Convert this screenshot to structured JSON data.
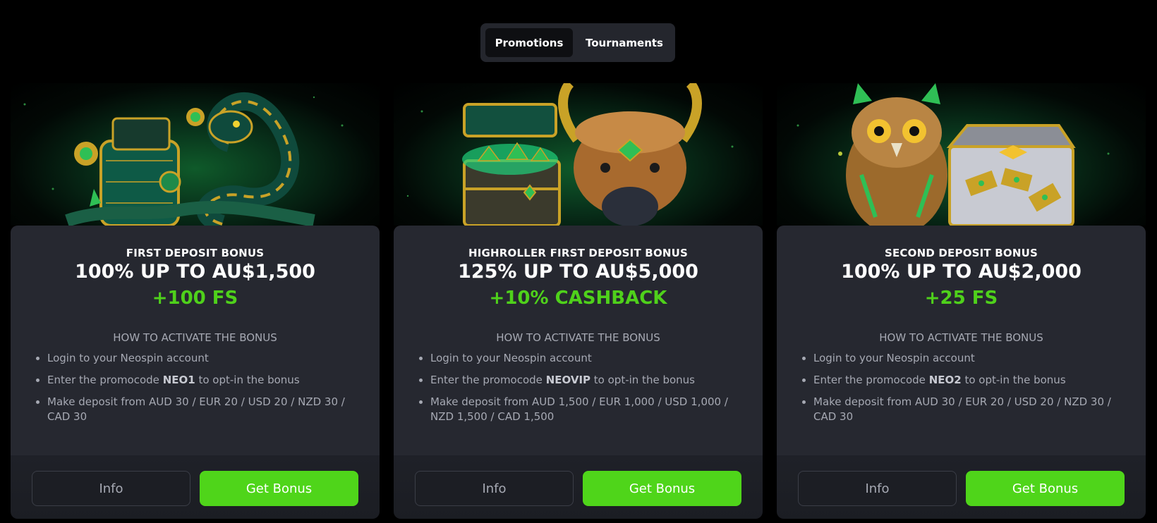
{
  "tabs": [
    {
      "label": "Promotions",
      "active": true
    },
    {
      "label": "Tournaments",
      "active": false
    }
  ],
  "colors": {
    "accent": "#4fd51a",
    "card": "#262830",
    "background": "#000000"
  },
  "cards": [
    {
      "title": "FIRST DEPOSIT BONUS",
      "headline": "100% UP TO AU$1,500",
      "extra": "+100 FS",
      "howto": "HOW TO ACTIVATE THE BONUS",
      "step1": "Login to your Neospin account",
      "step2_pre": "Enter the promocode ",
      "promocode": "NEO1",
      "step2_post": " to opt-in the bonus",
      "step3": "Make deposit from AUD 30 / EUR 20 / USD 20 / NZD 30 / CAD 30",
      "info_label": "Info",
      "get_label": "Get Bonus",
      "art": "snake-and-wallet"
    },
    {
      "title": "HIGHROLLER FIRST DEPOSIT BONUS",
      "headline": "125% UP TO AU$5,000",
      "extra": "+10% CASHBACK",
      "howto": "HOW TO ACTIVATE THE BONUS",
      "step1": "Login to your Neospin account",
      "step2_pre": "Enter the promocode ",
      "promocode": "NEOVIP",
      "step2_post": " to opt-in the bonus",
      "step3": "Make deposit from AUD 1,500 / EUR 1,000 / USD 1,000 / NZD 1,500 / CAD 1,500",
      "info_label": "Info",
      "get_label": "Get Bonus",
      "art": "bull-and-treasure-chest"
    },
    {
      "title": "SECOND DEPOSIT BONUS",
      "headline": "100% UP TO AU$2,000",
      "extra": "+25 FS",
      "howto": "HOW TO ACTIVATE THE BONUS",
      "step1": "Login to your Neospin account",
      "step2_pre": "Enter the promocode ",
      "promocode": "NEO2",
      "step2_post": " to opt-in the bonus",
      "step3": "Make deposit from AUD 30 / EUR 20 / USD 20 / NZD 30 / CAD 30",
      "info_label": "Info",
      "get_label": "Get Bonus",
      "art": "owl-and-gold-chest"
    }
  ]
}
